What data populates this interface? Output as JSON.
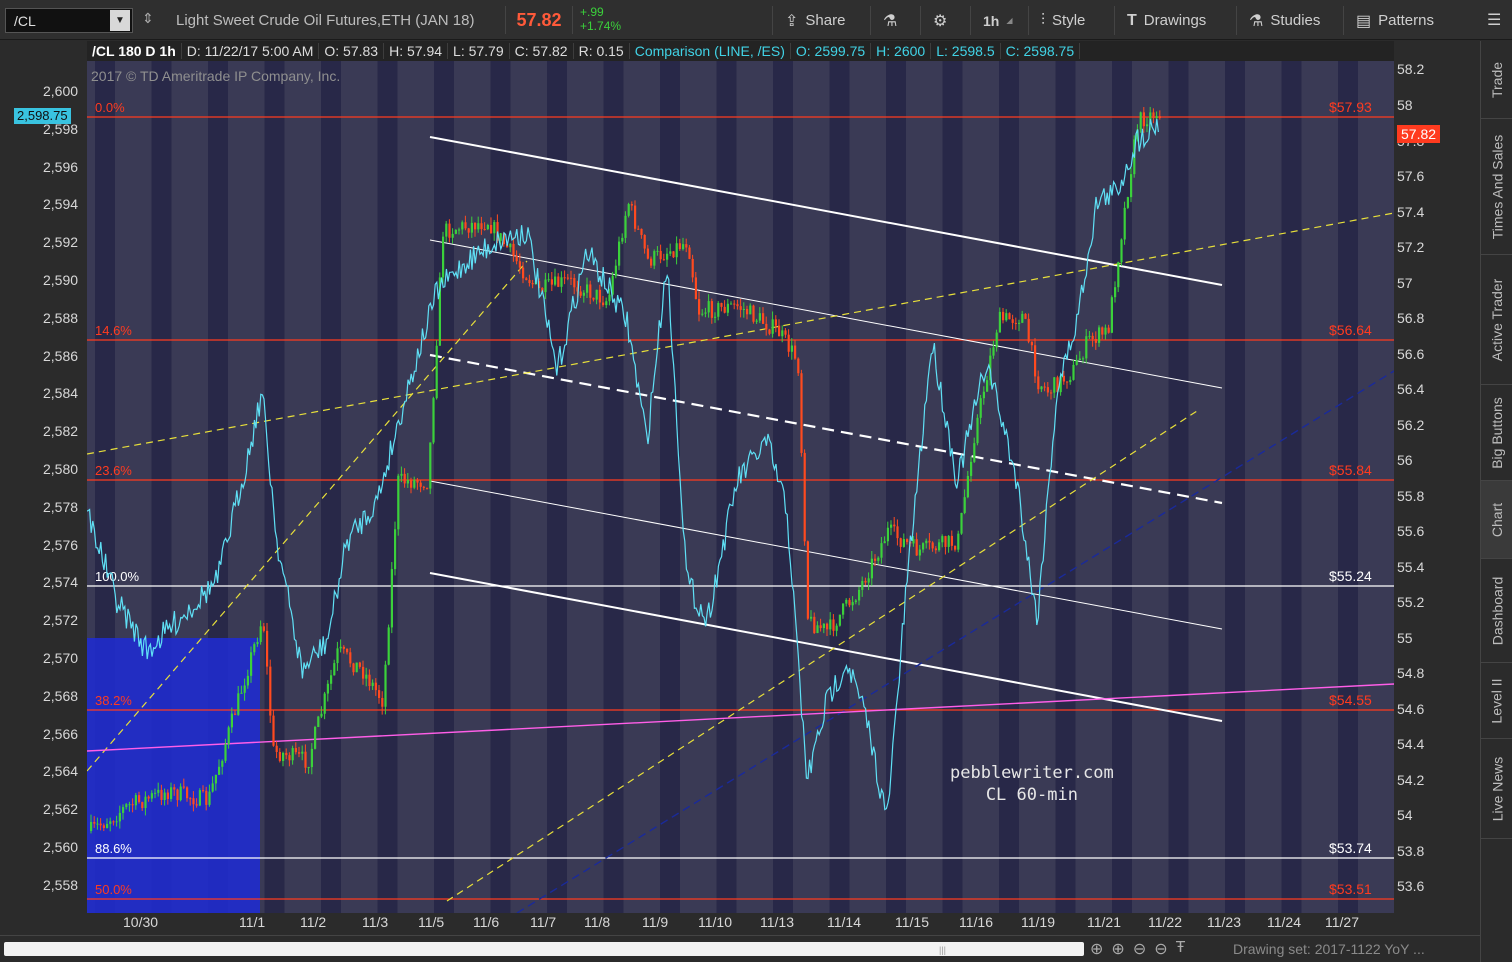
{
  "toolbar": {
    "symbol": "/CL",
    "title": "Light Sweet Crude Oil Futures,ETH (JAN 18)",
    "last_price": "57.82",
    "change": "+.99",
    "change_pct": "+1.74%",
    "share_label": "Share",
    "timeframe_label": "1h",
    "style_label": "Style",
    "drawings_label": "Drawings",
    "studies_label": "Studies",
    "patterns_label": "Patterns"
  },
  "info_strip": {
    "chart_id": "/CL 180 D 1h",
    "date": "D: 11/22/17 5:00 AM",
    "open": "O: 57.83",
    "high": "H: 57.94",
    "low": "L: 57.79",
    "close": "C: 57.82",
    "range": "R: 0.15",
    "comparison": "Comparison (LINE, /ES)",
    "cmp_open": "O: 2599.75",
    "cmp_high": "H: 2600",
    "cmp_low": "L: 2598.5",
    "cmp_close": "C: 2598.75"
  },
  "copyright": "2017 © TD Ameritrade IP Company, Inc.",
  "left_axis": {
    "ticks": [
      "2,600",
      "2,598",
      "2,596",
      "2,594",
      "2,592",
      "2,590",
      "2,588",
      "2,586",
      "2,584",
      "2,582",
      "2,580",
      "2,578",
      "2,576",
      "2,574",
      "2,572",
      "2,570",
      "2,568",
      "2,566",
      "2,564",
      "2,562",
      "2,560",
      "2,558"
    ],
    "current_label": "2,598.75"
  },
  "right_axis": {
    "ticks": [
      "58.2",
      "58",
      "57.8",
      "57.6",
      "57.4",
      "57.2",
      "57",
      "56.8",
      "56.6",
      "56.4",
      "56.2",
      "56",
      "55.8",
      "55.6",
      "55.4",
      "55.2",
      "55",
      "54.8",
      "54.6",
      "54.4",
      "54.2",
      "54",
      "53.8",
      "53.6"
    ],
    "current_label": "57.82"
  },
  "x_axis": {
    "labels": [
      "10/30",
      "11/1",
      "11/2",
      "11/3",
      "11/5",
      "11/6",
      "11/7",
      "11/8",
      "11/9",
      "11/10",
      "11/13",
      "11/14",
      "11/15",
      "11/16",
      "11/19",
      "11/21",
      "11/22",
      "11/23",
      "11/24",
      "11/27"
    ]
  },
  "fib_levels": [
    {
      "pct": "0.0%",
      "price": "$57.93",
      "color": "#ff3b1f"
    },
    {
      "pct": "14.6%",
      "price": "$56.64",
      "color": "#ff3b1f"
    },
    {
      "pct": "23.6%",
      "price": "$55.84",
      "color": "#ff3b1f"
    },
    {
      "pct": "100.0%",
      "price": "$55.24",
      "color": "#ffffff"
    },
    {
      "pct": "38.2%",
      "price": "$54.55",
      "color": "#ff3b1f"
    },
    {
      "pct": "88.6%",
      "price": "$53.74",
      "color": "#ffffff"
    },
    {
      "pct": "50.0%",
      "price": "$53.51",
      "color": "#ff3b1f"
    }
  ],
  "watermark": {
    "line1": "pebblewriter.com",
    "line2": "CL 60-min"
  },
  "side_tabs": [
    "Trade",
    "Times And Sales",
    "Active Trader",
    "Big Buttons",
    "Chart",
    "Dashboard",
    "Level II",
    "Live News"
  ],
  "bottom_bar": {
    "drawing_set": "Drawing set: 2017-1122 YoY ..."
  },
  "colors": {
    "up": "#3bd13b",
    "down": "#ff4a1f",
    "comparison": "#5fe0f5",
    "background": "#3a3a55",
    "band": "#262646"
  }
}
